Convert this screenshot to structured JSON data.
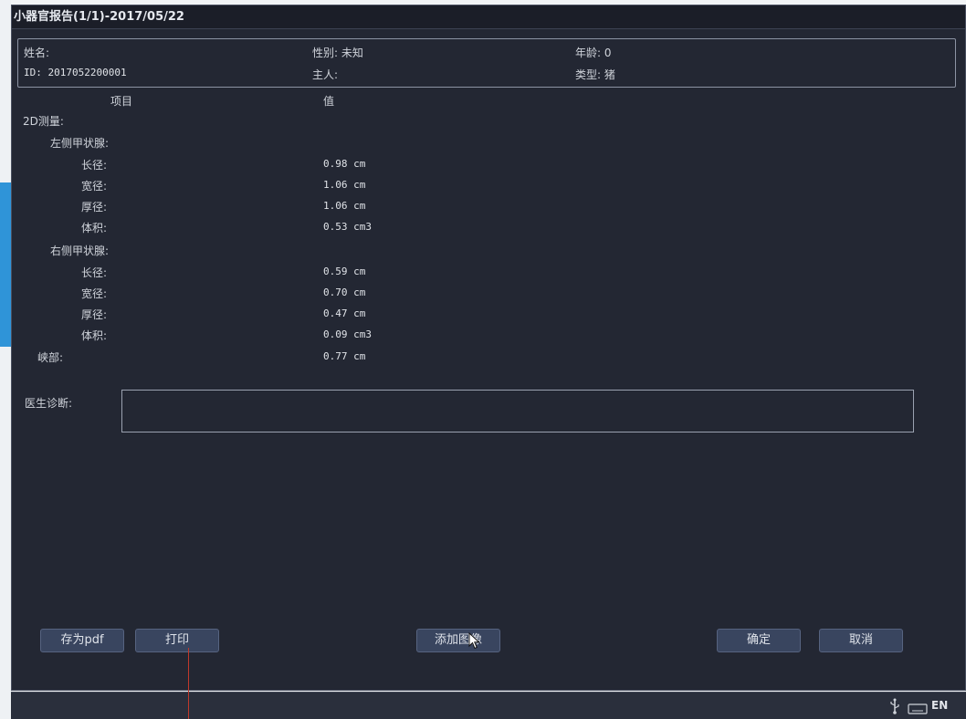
{
  "window": {
    "title": "小器官报告(1/1)-2017/05/22"
  },
  "patient": {
    "name_label": "姓名:",
    "id_label": "ID: 2017052200001",
    "gender_label": "性别: 未知",
    "owner_label": "主人:",
    "age_label": "年龄: 0",
    "type_label": "类型: 猪"
  },
  "table": {
    "col_item": "项目",
    "col_value": "值"
  },
  "measurements": {
    "section": "2D测量:",
    "left_group": "左侧甲状腺:",
    "left": [
      {
        "label": "长径:",
        "value": "0.98 cm"
      },
      {
        "label": "宽径:",
        "value": "1.06 cm"
      },
      {
        "label": "厚径:",
        "value": "1.06 cm"
      },
      {
        "label": "体积:",
        "value": "0.53 cm3"
      }
    ],
    "right_group": "右侧甲状腺:",
    "right": [
      {
        "label": "长径:",
        "value": "0.59 cm"
      },
      {
        "label": "宽径:",
        "value": "0.70 cm"
      },
      {
        "label": "厚径:",
        "value": "0.47 cm"
      },
      {
        "label": "体积:",
        "value": "0.09 cm3"
      }
    ],
    "isthmus": {
      "label": "峡部:",
      "value": "0.77 cm"
    }
  },
  "diagnosis": {
    "label": "医生诊断:",
    "value": ""
  },
  "buttons": {
    "save_pdf": "存为pdf",
    "print": "打印",
    "add_image": "添加图像",
    "confirm": "确定",
    "cancel": "取消"
  },
  "taskbar": {
    "usb_icon": "usb-icon",
    "keyboard_icon": "keyboard-icon",
    "lang": "EN"
  }
}
